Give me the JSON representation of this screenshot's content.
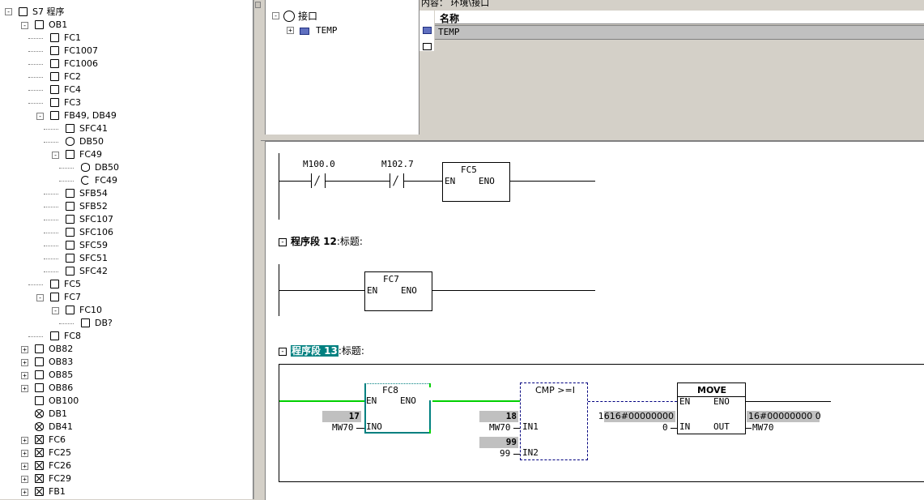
{
  "tree": {
    "root_label": "S7 程序",
    "items": [
      {
        "label": "OB1",
        "level": 1,
        "icon": "block",
        "pm": "-"
      },
      {
        "label": "FC1",
        "level": 2,
        "icon": "block"
      },
      {
        "label": "FC1007",
        "level": 2,
        "icon": "block"
      },
      {
        "label": "FC1006",
        "level": 2,
        "icon": "block"
      },
      {
        "label": "FC2",
        "level": 2,
        "icon": "block"
      },
      {
        "label": "FC4",
        "level": 2,
        "icon": "block"
      },
      {
        "label": "FC3",
        "level": 2,
        "icon": "block"
      },
      {
        "label": "FB49, DB49",
        "level": 2,
        "icon": "block",
        "pm": "-"
      },
      {
        "label": "SFC41",
        "level": 3,
        "icon": "block"
      },
      {
        "label": "DB50",
        "level": 3,
        "icon": "db"
      },
      {
        "label": "FC49",
        "level": 3,
        "icon": "block",
        "pm": "-"
      },
      {
        "label": "DB50",
        "level": 4,
        "icon": "db"
      },
      {
        "label": "FC49",
        "level": 4,
        "icon": "loop"
      },
      {
        "label": "SFB54",
        "level": 3,
        "icon": "block"
      },
      {
        "label": "SFB52",
        "level": 3,
        "icon": "block"
      },
      {
        "label": "SFC107",
        "level": 3,
        "icon": "block"
      },
      {
        "label": "SFC106",
        "level": 3,
        "icon": "block"
      },
      {
        "label": "SFC59",
        "level": 3,
        "icon": "block"
      },
      {
        "label": "SFC51",
        "level": 3,
        "icon": "block"
      },
      {
        "label": "SFC42",
        "level": 3,
        "icon": "block"
      },
      {
        "label": "FC5",
        "level": 2,
        "icon": "block"
      },
      {
        "label": "FC7",
        "level": 2,
        "icon": "block",
        "pm": "-"
      },
      {
        "label": "FC10",
        "level": 3,
        "icon": "block",
        "pm": "-"
      },
      {
        "label": "DB?",
        "level": 4,
        "icon": "block"
      },
      {
        "label": "FC8",
        "level": 2,
        "icon": "block"
      },
      {
        "label": "OB82",
        "level": 1,
        "icon": "block",
        "pm": "+"
      },
      {
        "label": "OB83",
        "level": 1,
        "icon": "block",
        "pm": "+"
      },
      {
        "label": "OB85",
        "level": 1,
        "icon": "block",
        "pm": "+"
      },
      {
        "label": "OB86",
        "level": 1,
        "icon": "block",
        "pm": "+"
      },
      {
        "label": "OB100",
        "level": 1,
        "icon": "block"
      },
      {
        "label": "DB1",
        "level": 1,
        "icon": "dbx"
      },
      {
        "label": "DB41",
        "level": 1,
        "icon": "dbx"
      },
      {
        "label": "FC6",
        "level": 1,
        "icon": "x",
        "pm": "+"
      },
      {
        "label": "FC25",
        "level": 1,
        "icon": "x",
        "pm": "+"
      },
      {
        "label": "FC26",
        "level": 1,
        "icon": "x",
        "pm": "+"
      },
      {
        "label": "FC29",
        "level": 1,
        "icon": "x",
        "pm": "+"
      },
      {
        "label": "FB1",
        "level": 1,
        "icon": "x",
        "pm": "+"
      }
    ]
  },
  "interface": {
    "root": "接口",
    "child": "TEMP"
  },
  "content": {
    "path": "内容：  环境\\接口",
    "col_header": "名称",
    "row1": "TEMP"
  },
  "networks": {
    "n11": {
      "contact1": "M100.0",
      "contact2": "M102.7",
      "box_title": "FC5",
      "en": "EN",
      "eno": "ENO"
    },
    "n12": {
      "title": "程序段 12",
      "subtitle": ":标题:",
      "box_title": "FC7",
      "en": "EN",
      "eno": "ENO"
    },
    "n13": {
      "title": "程序段 13",
      "subtitle": ":标题:",
      "fc8": {
        "title": "FC8",
        "en": "EN",
        "eno": "ENO",
        "in0": "INO",
        "val": "17",
        "param": "MW70"
      },
      "cmp": {
        "title": "CMP >=I",
        "in1": "IN1",
        "in2": "IN2",
        "v1": "18",
        "p1": "MW70",
        "v2": "99",
        "p2": "99"
      },
      "move": {
        "title": "MOVE",
        "en": "EN",
        "eno": "ENO",
        "in": "IN",
        "out": "OUT",
        "val_in": "1616#00000000",
        "p_in": "0",
        "val_out": "16#00000000 0",
        "p_out": "MW70"
      }
    }
  },
  "colors": {
    "powerflow": "#00d000",
    "selected": "#008080",
    "highlight": "#c0c0c0"
  }
}
